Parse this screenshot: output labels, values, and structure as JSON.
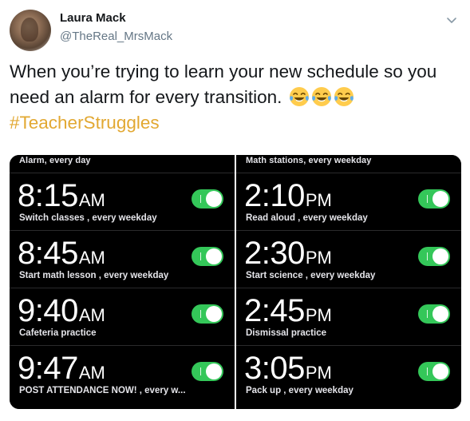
{
  "tweet": {
    "author_name": "Laura Mack",
    "author_handle": "@TheReal_MrsMack",
    "text": "When you’re trying to learn your new schedule so you need an alarm for every transition.",
    "hashtag": "#TeacherStruggles",
    "emoji_count": 3,
    "emoji_name": "tears-of-joy-emoji"
  },
  "colors": {
    "hashtag": "#e2a832",
    "toggle_on": "#34c759",
    "alarm_bg": "#000000"
  },
  "alarms": {
    "left": {
      "header": "Alarm, every day",
      "items": [
        {
          "time": "8:15",
          "ampm": "AM",
          "label": "Switch classes , every weekday",
          "enabled": true
        },
        {
          "time": "8:45",
          "ampm": "AM",
          "label": "Start math lesson , every weekday",
          "enabled": true
        },
        {
          "time": "9:40",
          "ampm": "AM",
          "label": "Cafeteria practice",
          "enabled": true
        },
        {
          "time": "9:47",
          "ampm": "AM",
          "label": "POST ATTENDANCE NOW! , every w...",
          "enabled": true
        }
      ]
    },
    "right": {
      "header": "Math stations, every weekday",
      "items": [
        {
          "time": "2:10",
          "ampm": "PM",
          "label": "Read aloud , every weekday",
          "enabled": true
        },
        {
          "time": "2:30",
          "ampm": "PM",
          "label": "Start science , every weekday",
          "enabled": true
        },
        {
          "time": "2:45",
          "ampm": "PM",
          "label": "Dismissal practice",
          "enabled": true
        },
        {
          "time": "3:05",
          "ampm": "PM",
          "label": "Pack up , every weekday",
          "enabled": true
        }
      ]
    }
  }
}
